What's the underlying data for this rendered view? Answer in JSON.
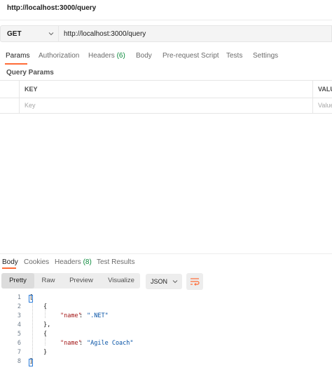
{
  "request": {
    "title": "http://localhost:3000/query",
    "method": "GET",
    "url": "http://localhost:3000/query"
  },
  "request_tabs": [
    {
      "label": "Params",
      "active": true
    },
    {
      "label": "Authorization",
      "active": false
    },
    {
      "label": "Headers",
      "count": "(6)",
      "active": false
    },
    {
      "label": "Body",
      "active": false
    },
    {
      "label": "Pre-request Script",
      "active": false
    },
    {
      "label": "Tests",
      "active": false
    },
    {
      "label": "Settings",
      "active": false
    }
  ],
  "query_params": {
    "section_label": "Query Params",
    "columns": [
      "KEY",
      "VALU"
    ],
    "placeholders": [
      "Key",
      "Value"
    ]
  },
  "response_tabs": [
    {
      "label": "Body",
      "active": true
    },
    {
      "label": "Cookies",
      "active": false
    },
    {
      "label": "Headers",
      "count": "(8)",
      "active": false
    },
    {
      "label": "Test Results",
      "active": false
    }
  ],
  "view_modes": [
    "Pretty",
    "Raw",
    "Preview",
    "Visualize"
  ],
  "active_view": "Pretty",
  "format": "JSON",
  "response_body": {
    "line_numbers": [
      "1",
      "2",
      "3",
      "4",
      "5",
      "6",
      "7",
      "8"
    ],
    "items": [
      {
        "key": "\"name\"",
        "value": "\".NET\""
      },
      {
        "key": "\"name\"",
        "value": "\"Agile Coach\""
      }
    ]
  },
  "colors": {
    "accent": "#ff6c37",
    "count_green": "#0a8a3b",
    "json_key": "#a31515",
    "json_string": "#0451a5"
  },
  "icons": {
    "method_dropdown": "chevron-down-icon",
    "format_dropdown": "chevron-down-icon",
    "wrap": "wrap-lines-icon"
  }
}
